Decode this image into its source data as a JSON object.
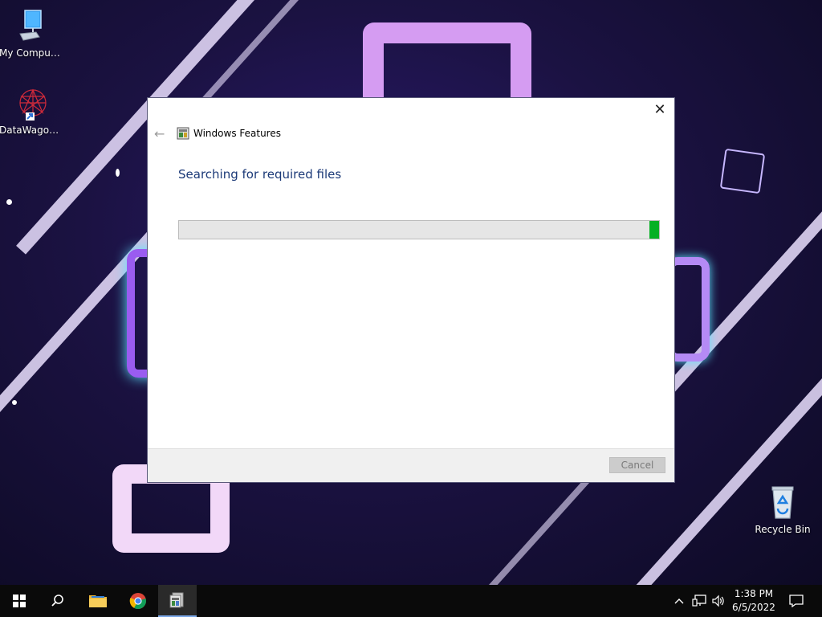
{
  "desktop": {
    "icons": [
      {
        "label": "My Computer"
      },
      {
        "label": "DataWagon..."
      },
      {
        "label": "Recycle Bin"
      }
    ]
  },
  "dialog": {
    "title": "Windows Features",
    "heading": "Searching for required files",
    "progress_fraction": 0.98,
    "cancel_label": "Cancel",
    "close_glyph": "✕",
    "back_glyph": "←"
  },
  "taskbar": {
    "pinned": [
      "start-icon",
      "search-icon",
      "file-explorer-icon",
      "chrome-icon",
      "windows-features-icon"
    ],
    "time": "1:38 PM",
    "date": "6/5/2022"
  },
  "colors": {
    "accent_heading": "#1c3a78",
    "progress_green": "#06b025",
    "taskbar_bg": "#0a0a0a"
  }
}
